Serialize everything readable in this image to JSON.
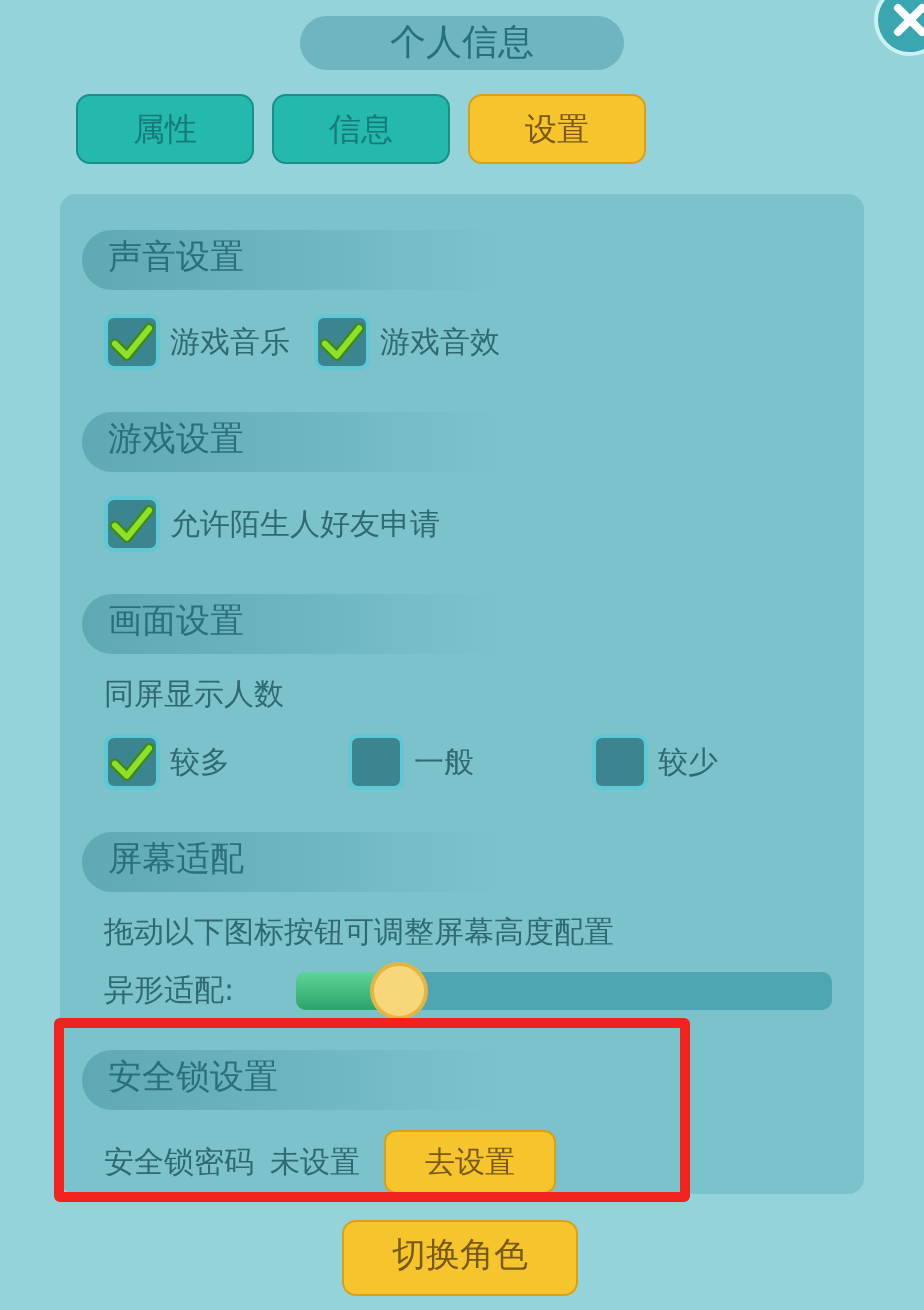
{
  "title": "个人信息",
  "tabs": [
    {
      "label": "属性",
      "selected": false
    },
    {
      "label": "信息",
      "selected": false
    },
    {
      "label": "设置",
      "selected": true
    }
  ],
  "sections": [
    {
      "title": "声音设置",
      "highlighted": false,
      "rows": [
        {
          "kind": "checkboxes",
          "options": [
            {
              "label": "游戏音乐",
              "checked": true
            },
            {
              "label": "游戏音效",
              "checked": true
            }
          ]
        }
      ]
    },
    {
      "title": "游戏设置",
      "highlighted": false,
      "rows": [
        {
          "kind": "checkboxes",
          "options": [
            {
              "label": "允许陌生人好友申请",
              "checked": true
            }
          ]
        }
      ]
    },
    {
      "title": "画面设置",
      "highlighted": false,
      "rows": [
        {
          "kind": "text",
          "text": "同屏显示人数"
        },
        {
          "kind": "radios",
          "options": [
            {
              "label": "较多",
              "selected": true
            },
            {
              "label": "一般",
              "selected": false
            },
            {
              "label": "较少",
              "selected": false
            }
          ]
        }
      ]
    },
    {
      "title": "屏幕适配",
      "highlighted": false,
      "rows": [
        {
          "kind": "text",
          "text": "拖动以下图标按钮可调整屏幕高度配置"
        },
        {
          "kind": "slider",
          "label": "异形适配:",
          "level": 0.19
        }
      ]
    },
    {
      "title": "安全锁设置",
      "highlighted": true,
      "rows": [
        {
          "kind": "lock",
          "label": "安全锁密码",
          "status": "未设置",
          "button": "去设置"
        }
      ]
    }
  ],
  "footer_button": "切换角色"
}
